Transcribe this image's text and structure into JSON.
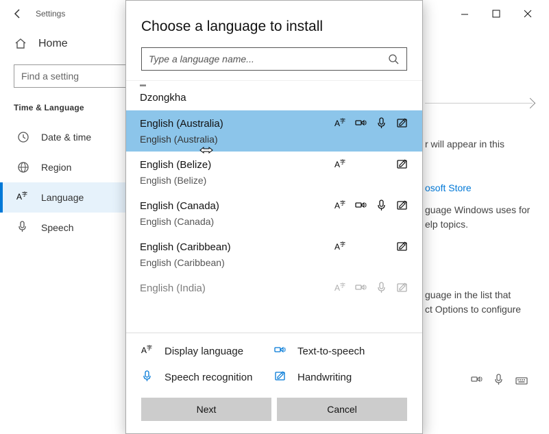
{
  "titlebar": {
    "title": "Settings"
  },
  "sidebar": {
    "home": "Home",
    "find_placeholder": "Find a setting",
    "section": "Time & Language",
    "items": [
      {
        "label": "Date & time"
      },
      {
        "label": "Region"
      },
      {
        "label": "Language"
      },
      {
        "label": "Speech"
      }
    ]
  },
  "right": {
    "line1": "r will appear in this",
    "link": "osoft Store",
    "line2": "guage Windows uses for",
    "line3": "elp topics.",
    "line4": "guage in the list that",
    "line5": "ct Options to configure"
  },
  "dialog": {
    "title": "Choose a language to install",
    "search_placeholder": "Type a language name...",
    "languages": [
      {
        "name": "Dzongkha",
        "sub": "",
        "features": []
      },
      {
        "name": "English (Australia)",
        "sub": "English (Australia)",
        "features": [
          "display",
          "tts",
          "speech",
          "hand"
        ],
        "selected": true
      },
      {
        "name": "English (Belize)",
        "sub": "English (Belize)",
        "features": [
          "display",
          "hand"
        ]
      },
      {
        "name": "English (Canada)",
        "sub": "English (Canada)",
        "features": [
          "display",
          "tts",
          "speech",
          "hand"
        ]
      },
      {
        "name": "English (Caribbean)",
        "sub": "English (Caribbean)",
        "features": [
          "display",
          "hand"
        ]
      },
      {
        "name": "English (India)",
        "sub": "",
        "features": [
          "display",
          "tts",
          "speech",
          "hand"
        ],
        "cut": true
      }
    ],
    "legend": {
      "display": "Display language",
      "tts": "Text-to-speech",
      "speech": "Speech recognition",
      "hand": "Handwriting"
    },
    "buttons": {
      "next": "Next",
      "cancel": "Cancel"
    }
  }
}
